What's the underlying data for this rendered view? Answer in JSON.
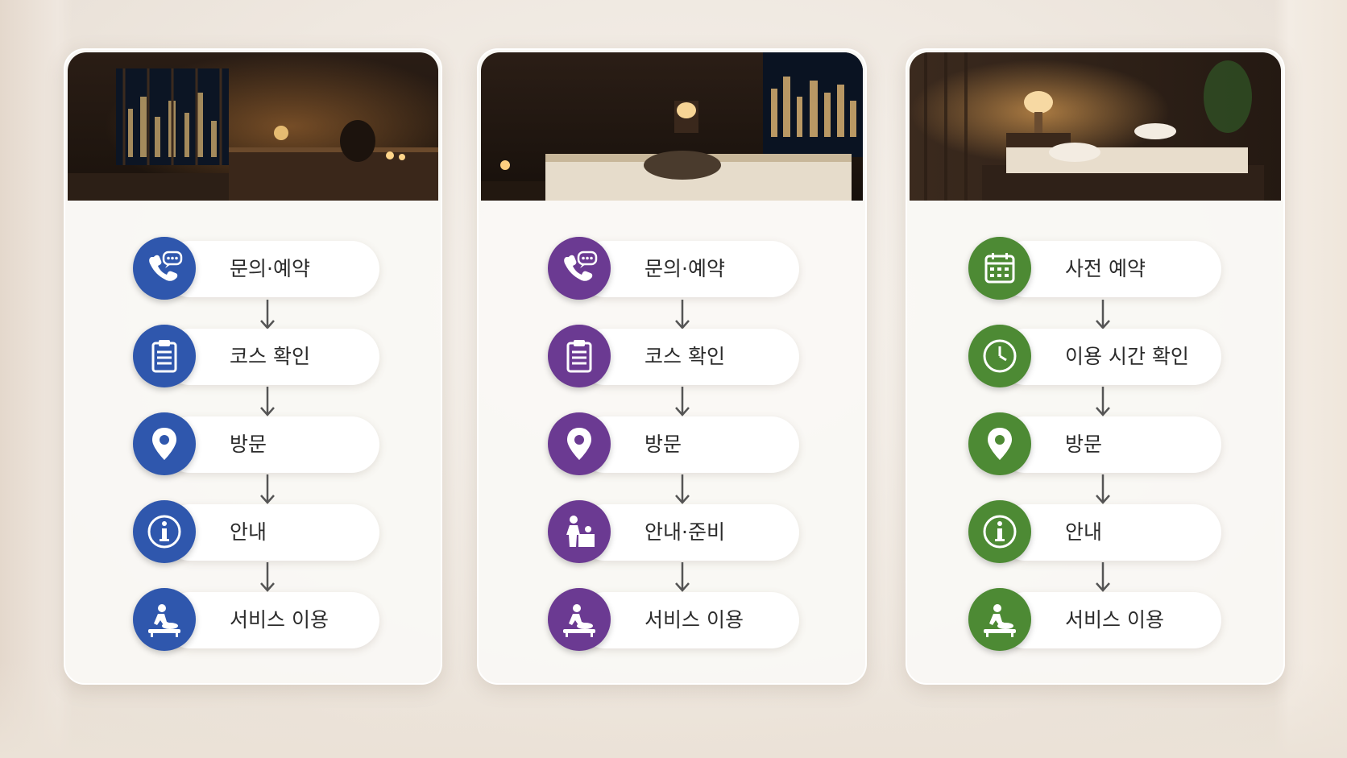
{
  "colors": {
    "blue": "#2f57ad",
    "purple": "#6b3a92",
    "green": "#4d8a34"
  },
  "cards": [
    {
      "accent": "blue",
      "steps": [
        {
          "label": "문의·예약",
          "icon": "phone-chat-icon"
        },
        {
          "label": "코스 확인",
          "icon": "clipboard-icon"
        },
        {
          "label": "방문",
          "icon": "location-pin-icon"
        },
        {
          "label": "안내",
          "icon": "info-icon"
        },
        {
          "label": "서비스 이용",
          "icon": "massage-icon"
        }
      ]
    },
    {
      "accent": "purple",
      "steps": [
        {
          "label": "문의·예약",
          "icon": "phone-chat-icon"
        },
        {
          "label": "코스 확인",
          "icon": "clipboard-icon"
        },
        {
          "label": "방문",
          "icon": "location-pin-icon"
        },
        {
          "label": "안내·준비",
          "icon": "preparation-icon"
        },
        {
          "label": "서비스 이용",
          "icon": "massage-icon"
        }
      ]
    },
    {
      "accent": "green",
      "steps": [
        {
          "label": "사전 예약",
          "icon": "calendar-icon"
        },
        {
          "label": "이용 시간 확인",
          "icon": "clock-icon"
        },
        {
          "label": "방문",
          "icon": "location-pin-icon"
        },
        {
          "label": "안내",
          "icon": "info-icon"
        },
        {
          "label": "서비스 이용",
          "icon": "massage-icon"
        }
      ]
    }
  ]
}
